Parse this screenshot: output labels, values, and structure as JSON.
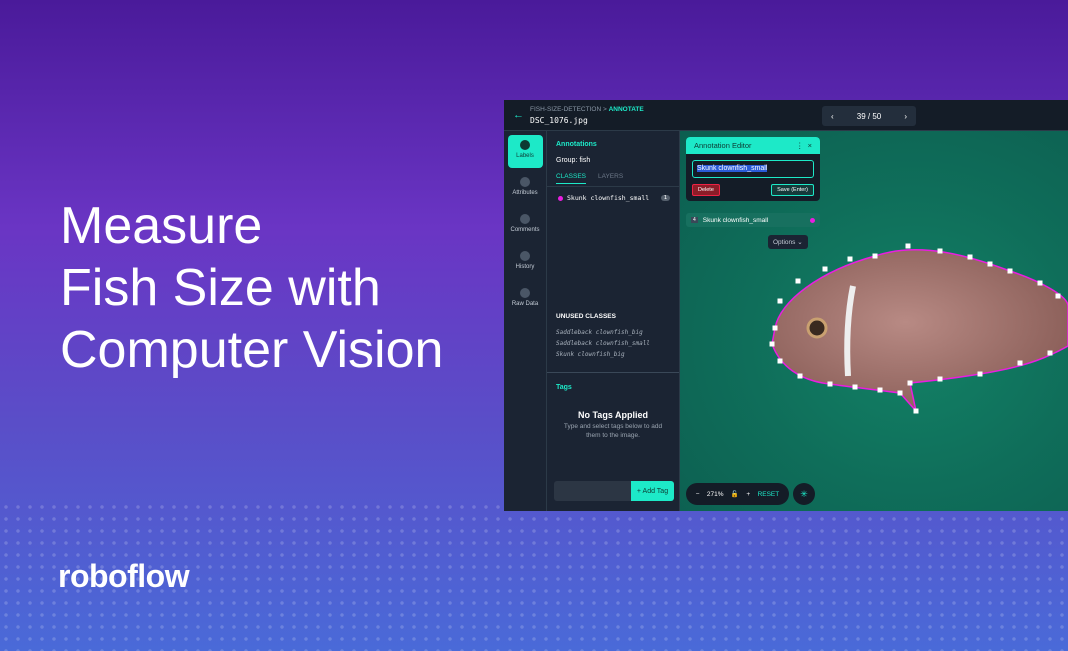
{
  "headline": {
    "line1": "Measure",
    "line2": "Fish Size with",
    "line3": "Computer Vision"
  },
  "logo": "roboflow",
  "app": {
    "breadcrumb": {
      "project": "FISH-SIZE-DETECTION",
      "separator": ">",
      "section": "ANNOTATE"
    },
    "filename": "DSC_1076.jpg",
    "pager": {
      "text": "39 / 50",
      "prev": "‹",
      "next": "›"
    },
    "rail": [
      {
        "label": "Labels",
        "active": true
      },
      {
        "label": "Attributes"
      },
      {
        "label": "Comments"
      },
      {
        "label": "History"
      },
      {
        "label": "Raw Data"
      }
    ],
    "panel": {
      "title": "Annotations",
      "group": "Group: fish",
      "tabs": [
        "CLASSES",
        "LAYERS"
      ],
      "classes": [
        {
          "name": "Skunk clownfish_small",
          "count": "1",
          "color": "#e91ee0"
        }
      ],
      "unused_title": "UNUSED CLASSES",
      "unused": [
        "Saddleback clownfish_big",
        "Saddleback clownfish_small",
        "Skunk clownfish_big"
      ],
      "tags_title": "Tags",
      "no_tags": "No Tags Applied",
      "no_tags_sub": "Type and select tags below to add them to the image.",
      "add_tag": "+ Add Tag"
    },
    "editor": {
      "title": "Annotation Editor",
      "menu": "⋮",
      "close": "×",
      "value": "Skunk clownfish_small",
      "delete": "Delete",
      "save": "Save (Enter)"
    },
    "label_row": {
      "num": "4",
      "name": "Skunk clownfish_small"
    },
    "options": "Options ⌄",
    "zoom": {
      "minus": "−",
      "value": "271%",
      "lock": "🔓",
      "plus": "+",
      "reset": "RESET",
      "magic": "✳"
    },
    "colors": {
      "accent": "#1de9c8",
      "polygon": "#e91ee0"
    }
  }
}
